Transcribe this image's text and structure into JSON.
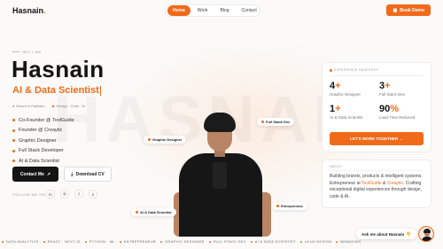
{
  "header": {
    "logo": "Hasnain",
    "logo_dot": ".",
    "nav": [
      "Home",
      "Work",
      "Blog",
      "Contact"
    ],
    "book_demo": "Book Demo",
    "accent": "#f06a1a"
  },
  "hero": {
    "eyebrow": "HEY I AM",
    "name": "Hasnain",
    "role": "AI & Data Scientist",
    "meta_location": "Based in Pakistan",
    "meta_tagline": "Design · Code · AI",
    "points": [
      "Co-Founder @ ToolGuide",
      "Founder @ Creaytic",
      "Graphic Designer",
      "Full Stack Developer",
      "AI & Data Scientist"
    ],
    "contact_btn": "Contact Me",
    "cv_btn": "Download CV",
    "follow": "FOLLOW ME ON",
    "socials": [
      "in",
      "ig",
      "f",
      "x"
    ],
    "watermark": "HASNAIN"
  },
  "tags": {
    "full_stack": "Full Stack Dev",
    "graphic": "Graphic Designer",
    "ai": "AI & Data Scientist",
    "entrepreneur": "Entrepreneur"
  },
  "snapshot": {
    "title": "EXPERIENCE SNAPSHOT",
    "stats": [
      {
        "num": "4",
        "plus": "+",
        "label": "Graphic Designer"
      },
      {
        "num": "3",
        "plus": "+",
        "label": "Full Stack Dev"
      },
      {
        "num": "1",
        "plus": "+",
        "label": "AI & Data Scientist"
      },
      {
        "num": "90",
        "plus": "%",
        "label": "Load Time Reduced"
      }
    ],
    "work_btn": "LET'S WORK TOGETHER →"
  },
  "about": {
    "title": "ABOUT",
    "text_a": "Building brands, products & intelligent systems. Entrepreneur at ",
    "hl1": "ToolGuide",
    "text_b": " & ",
    "hl2": "Creaytic",
    "text_c": ". Crafting exceptional digital experiences through design, code & AI."
  },
  "chat": {
    "label": "Ask me about Hasnain",
    "emoji": "👋"
  },
  "marquee": [
    "DATA ANALYTICS",
    "REACT · NEXT.JS",
    "PYTHON · ML",
    "ENTREPRENEUR",
    "GRAPHIC DESIGNER",
    "FULL STACK DEV",
    "AI & DATA SCIENTIST",
    "UI/UX DESIGN",
    "BRANDING"
  ]
}
